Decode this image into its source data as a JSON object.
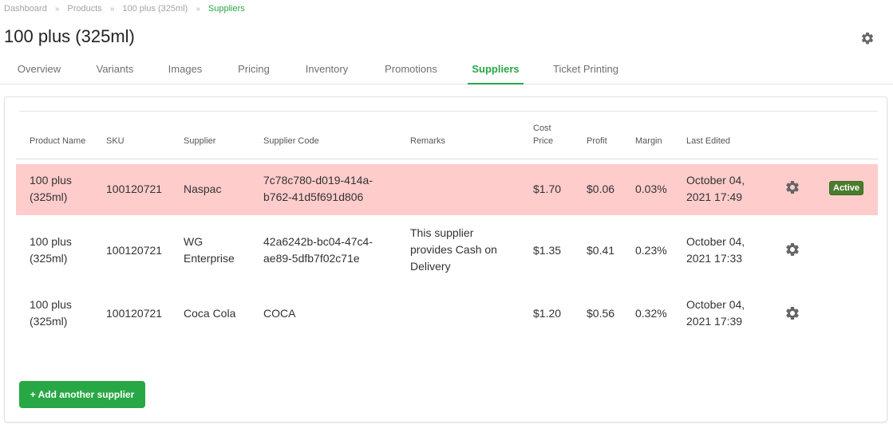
{
  "breadcrumb": {
    "items": [
      "Dashboard",
      "Products",
      "100 plus (325ml)",
      "Suppliers"
    ],
    "separator": "»"
  },
  "page": {
    "title": "100 plus (325ml)",
    "settings_icon": "gear-icon"
  },
  "tabs": [
    {
      "label": "Overview",
      "active": false
    },
    {
      "label": "Variants",
      "active": false
    },
    {
      "label": "Images",
      "active": false
    },
    {
      "label": "Pricing",
      "active": false
    },
    {
      "label": "Inventory",
      "active": false
    },
    {
      "label": "Promotions",
      "active": false
    },
    {
      "label": "Suppliers",
      "active": true
    },
    {
      "label": "Ticket Printing",
      "active": false
    }
  ],
  "table": {
    "columns": [
      "Product Name",
      "SKU",
      "Supplier",
      "Supplier Code",
      "Remarks",
      "Cost Price",
      "Profit",
      "Margin",
      "Last Edited"
    ],
    "cost_price_header": [
      "Cost",
      "Price"
    ],
    "rows": [
      {
        "product_name": [
          "100 plus",
          "(325ml)"
        ],
        "sku": "100120721",
        "supplier": [
          "Naspac"
        ],
        "supplier_code": [
          "7c78c780-d019-414a-",
          "b762-41d5f691d806"
        ],
        "remarks": [],
        "cost_price": "$1.70",
        "profit": "$0.06",
        "margin": "0.03%",
        "last_edited": [
          "October 04,",
          "2021 17:49"
        ],
        "status": "Active",
        "highlighted": true
      },
      {
        "product_name": [
          "100 plus",
          "(325ml)"
        ],
        "sku": "100120721",
        "supplier": [
          "WG",
          "Enterprise"
        ],
        "supplier_code": [
          "42a6242b-bc04-47c4-",
          "ae89-5dfb7f02c71e"
        ],
        "remarks": [
          "This supplier",
          "provides Cash on",
          "Delivery"
        ],
        "cost_price": "$1.35",
        "profit": "$0.41",
        "margin": "0.23%",
        "last_edited": [
          "October 04,",
          "2021 17:33"
        ],
        "status": "",
        "highlighted": false
      },
      {
        "product_name": [
          "100 plus",
          "(325ml)"
        ],
        "sku": "100120721",
        "supplier": [
          "Coca Cola"
        ],
        "supplier_code": [
          "COCA"
        ],
        "remarks": [],
        "cost_price": "$1.20",
        "profit": "$0.56",
        "margin": "0.32%",
        "last_edited": [
          "October 04,",
          "2021 17:39"
        ],
        "status": "",
        "highlighted": false
      }
    ],
    "row_action_icon": "gear-icon"
  },
  "actions": {
    "add_supplier_label": "+ Add another supplier"
  },
  "colors": {
    "accent": "#28a745",
    "highlight_row": "#ffcccc",
    "active_badge": "#4a7c2d",
    "gear": "#666666"
  }
}
